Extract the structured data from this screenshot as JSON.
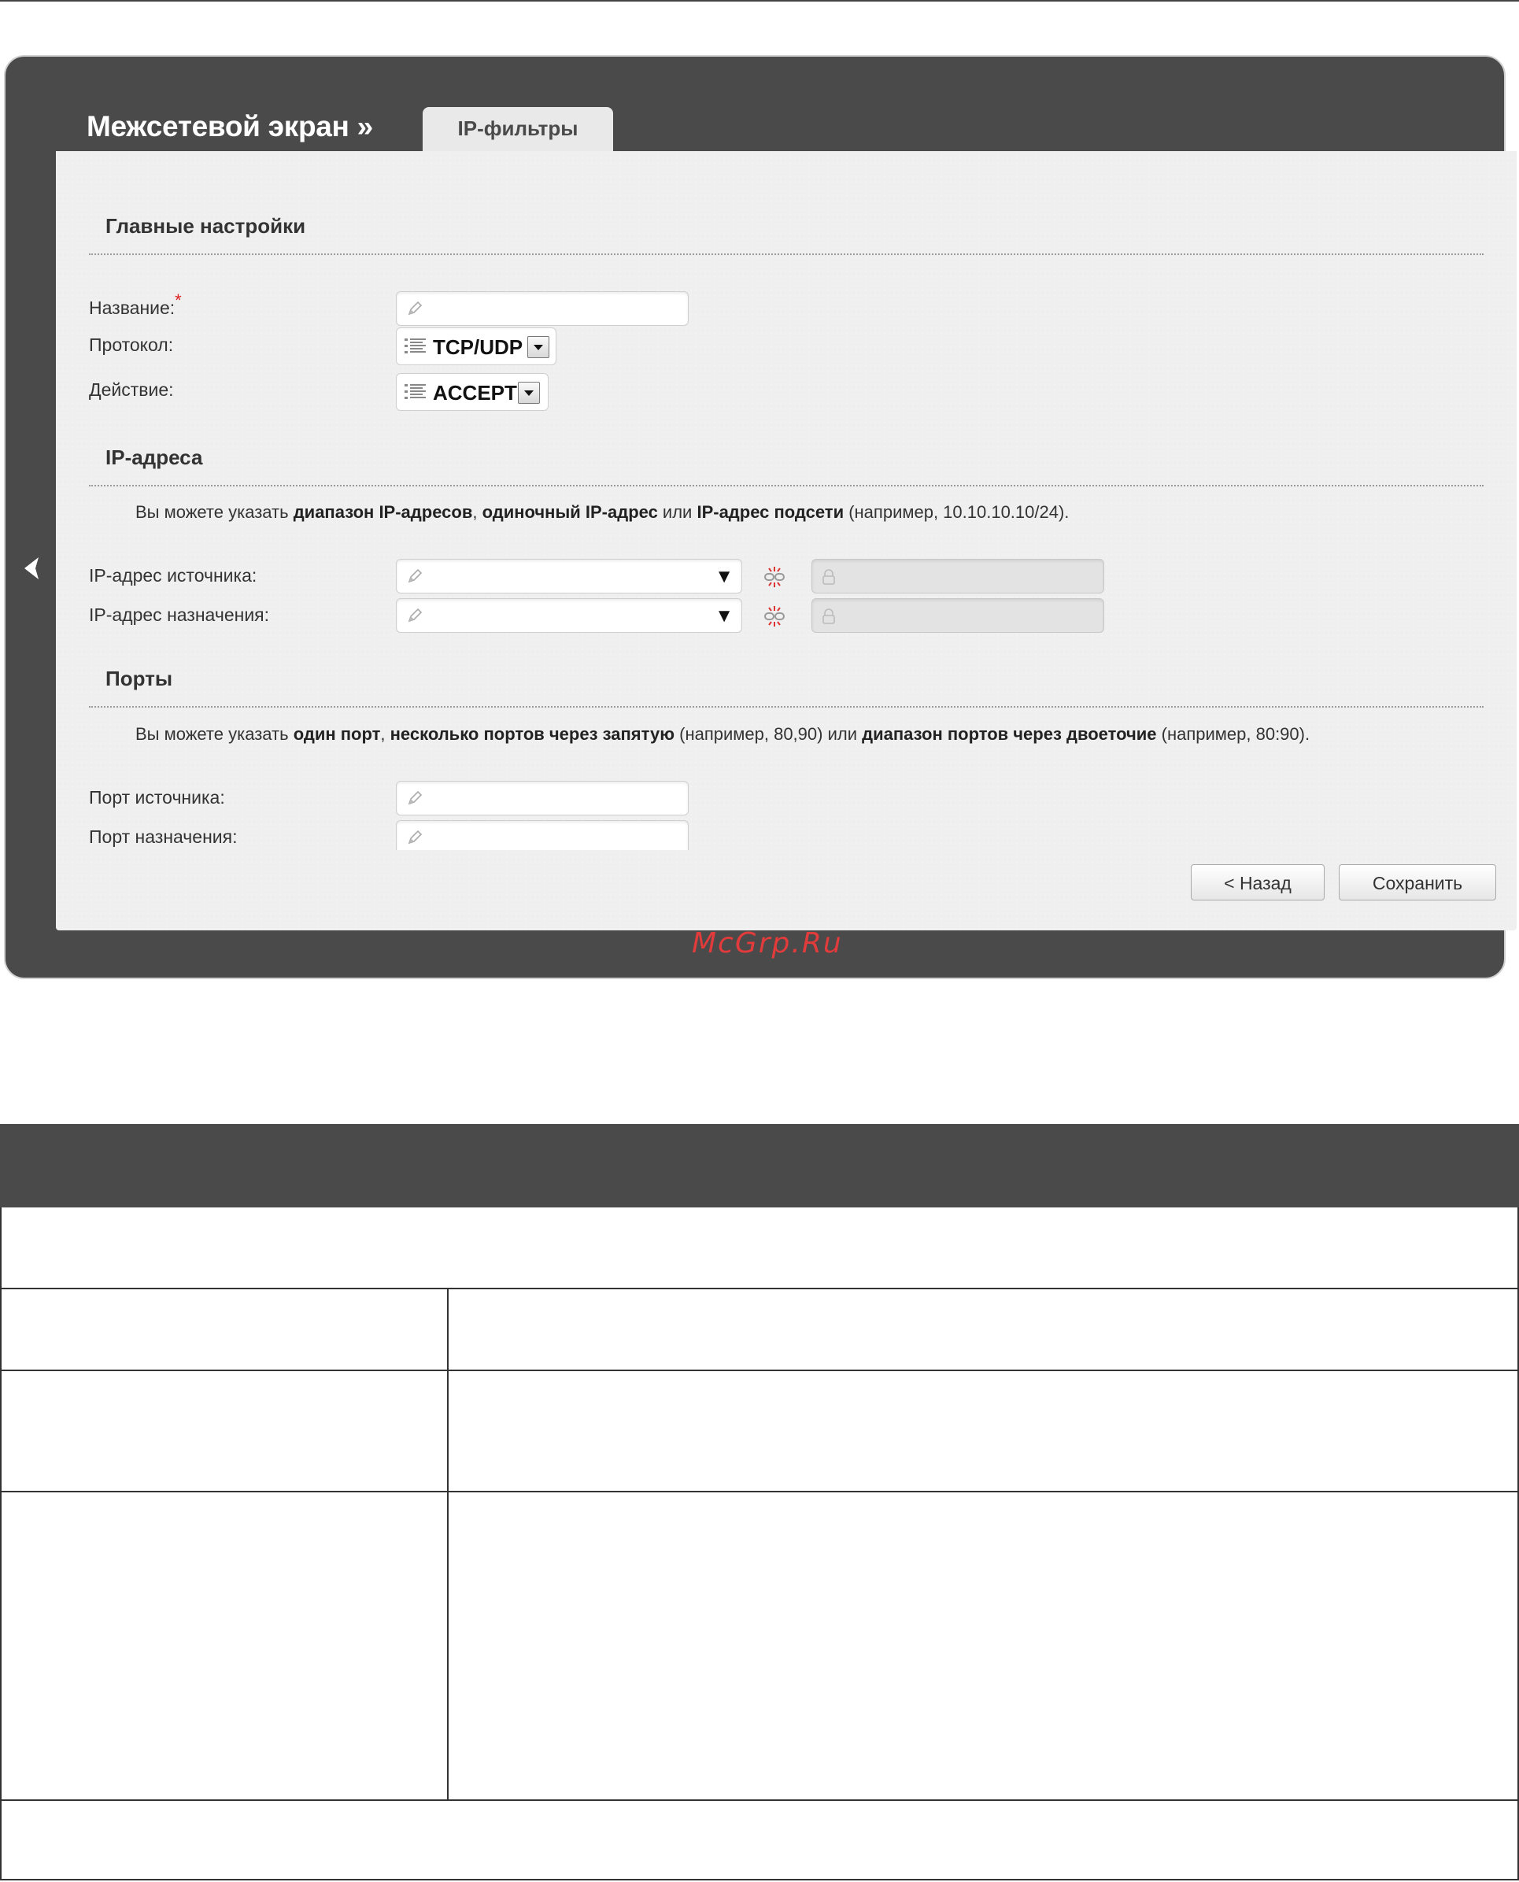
{
  "header": {
    "title": "Межсетевой экран »",
    "tab": "IP-фильтры"
  },
  "watermark": "McGrp.Ru",
  "main_settings": {
    "section_title": "Главные настройки",
    "name_label": "Название:",
    "required_mark": "*",
    "name_value": "",
    "protocol_label": "Протокол:",
    "protocol_value": "TCP/UDP",
    "action_label": "Действие:",
    "action_value": "ACCEPT"
  },
  "ip_addresses": {
    "section_title": "IP-адреса",
    "hint_parts": [
      "Вы можете указать ",
      "диапазон IP-адресов",
      ", ",
      "одиночный IP-адрес",
      " или ",
      "IP-адрес подсети",
      " (например, 10.10.10.10/24)."
    ],
    "source_label": "IP-адрес источника:",
    "source_value": "",
    "destination_label": "IP-адрес назначения:",
    "destination_value": ""
  },
  "ports": {
    "section_title": "Порты",
    "hint_parts": [
      "Вы можете указать ",
      "один порт",
      ", ",
      "несколько портов через запятую",
      " (например, 80,90) или ",
      "диапазон портов через двоеточие",
      " (например, 80:90)."
    ],
    "source_label": "Порт источника:",
    "source_value": "",
    "destination_label": "Порт назначения:",
    "destination_value": ""
  },
  "buttons": {
    "back": "< Назад",
    "save": "Сохранить"
  },
  "icons": {
    "nav": "chevron-left-icon",
    "edit": "pencil-icon",
    "list": "list-icon",
    "link": "broken-link-icon",
    "lock": "lock-icon"
  }
}
